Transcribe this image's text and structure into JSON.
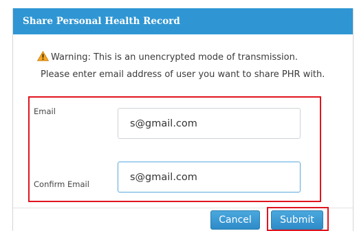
{
  "dialog": {
    "title": "Share Personal Health Record",
    "warning_text": "Warning: This is an unencrypted mode of transmission.",
    "info_text": "Please enter email address of user you want to share PHR with.",
    "warning_icon": "warning-triangle-icon",
    "colors": {
      "titlebar": "#2f96d3",
      "button": "#2e8bc8",
      "highlight": "#e0141e",
      "warning_icon": "#f5a623"
    }
  },
  "form": {
    "email_label": "Email",
    "email_value": "s@gmail.com",
    "confirm_label": "Confirm Email",
    "confirm_value": "s@gmail.com"
  },
  "buttons": {
    "cancel_label": "Cancel",
    "submit_label": "Submit"
  }
}
